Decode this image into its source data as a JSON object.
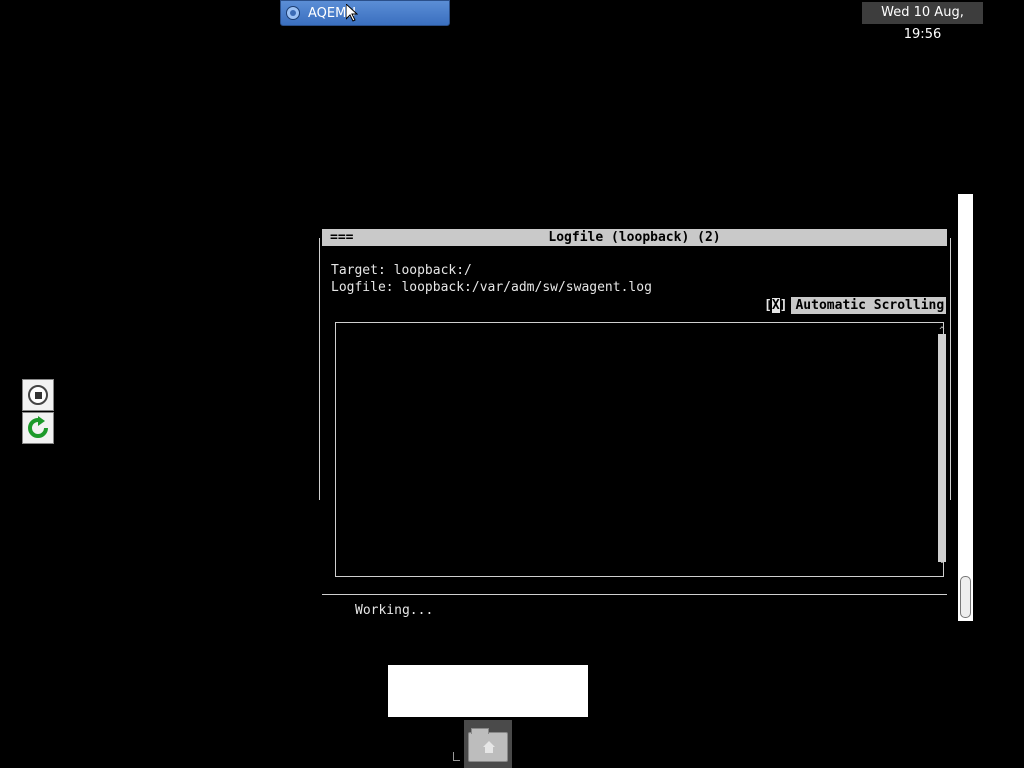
{
  "taskbar": {
    "app_button_label": "AQEMU",
    "clock": "Wed 10 Aug, 19:56"
  },
  "side_icons": [
    "stop-icon",
    "refresh-icon"
  ],
  "dialog": {
    "menu_marker": "===",
    "title": "Logfile (loopback) (2)",
    "target_line": "Target: loopback:/",
    "logfile_line": "Logfile: loopback:/var/adm/sw/swagent.log",
    "autoscroll_open": "[",
    "autoscroll_mark": "X",
    "autoscroll_close": "]",
    "autoscroll_label": "Automatic Scrolling",
    "scroll_up": "^",
    "scroll_down": "v",
    "status": "Working..."
  },
  "colors": {
    "desktop": "#000000",
    "taskbar_button": "#3a6fbf",
    "titlebar": "#c9c9c9"
  }
}
